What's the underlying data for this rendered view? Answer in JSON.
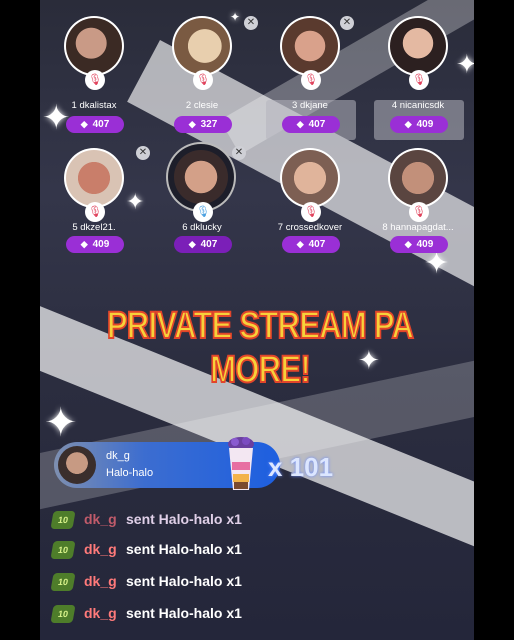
{
  "seats": [
    {
      "rank": "1",
      "username": "dkalistax",
      "score": "407"
    },
    {
      "rank": "2",
      "username": "clesie",
      "score": "327"
    },
    {
      "rank": "3",
      "username": "dkjane",
      "score": "407"
    },
    {
      "rank": "4",
      "username": "nicanicsdk",
      "score": "409"
    },
    {
      "rank": "5",
      "username": "dkzel21.",
      "score": "409"
    },
    {
      "rank": "6",
      "username": "dklucky",
      "score": "407"
    },
    {
      "rank": "7",
      "username": "crossedkover",
      "score": "407"
    },
    {
      "rank": "8",
      "username": "hannapagdat...",
      "score": "409"
    }
  ],
  "banner": {
    "line1": "PRIVATE STREAM PA",
    "line2": "MORE!"
  },
  "gift": {
    "sender": "dk_g",
    "gift_name": "Halo-halo",
    "multiplier": "x 101"
  },
  "chat": [
    {
      "level": "10",
      "user": "dk_g",
      "text": "sent Halo-halo x1"
    },
    {
      "level": "10",
      "user": "dk_g",
      "text": "sent Halo-halo x1"
    },
    {
      "level": "10",
      "user": "dk_g",
      "text": "sent Halo-halo x1"
    },
    {
      "level": "10",
      "user": "dk_g",
      "text": "sent Halo-halo x1"
    }
  ],
  "colors": {
    "pill": "#9a2fd6",
    "gift_bar": "#1d5fe0",
    "banner_fill": "#f7d23a",
    "banner_stroke": "#e2452a"
  },
  "icons": {
    "mic": "microphone-icon",
    "gem": "diamond-icon",
    "close": "close-icon"
  }
}
